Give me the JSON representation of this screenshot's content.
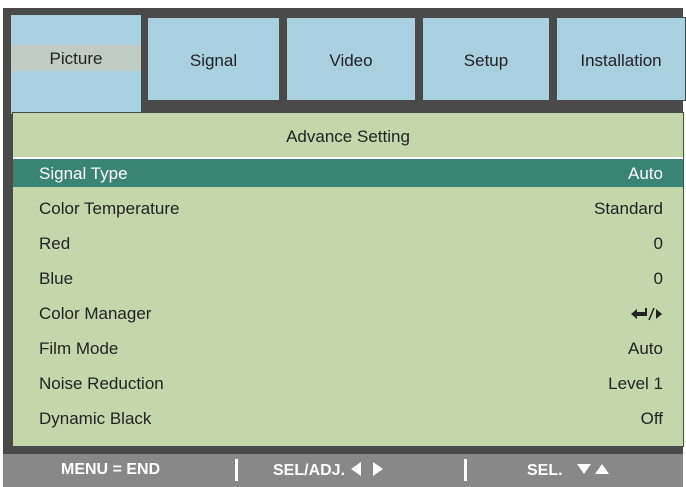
{
  "tabs": [
    {
      "label": "Picture",
      "active": true
    },
    {
      "label": "Signal",
      "active": false
    },
    {
      "label": "Video",
      "active": false
    },
    {
      "label": "Setup",
      "active": false
    },
    {
      "label": "Installation",
      "active": false
    }
  ],
  "panel": {
    "title": "Advance Setting",
    "rows": [
      {
        "label": "Signal Type",
        "value": "Auto",
        "selected": true
      },
      {
        "label": "Color Temperature",
        "value": "Standard"
      },
      {
        "label": "Red",
        "value": "0"
      },
      {
        "label": "Blue",
        "value": "0"
      },
      {
        "label": "Color Manager",
        "value": ""
      },
      {
        "label": "Film Mode",
        "value": "Auto"
      },
      {
        "label": "Noise Reduction",
        "value": "Level 1"
      },
      {
        "label": "Dynamic Black",
        "value": "Off"
      }
    ]
  },
  "footer": {
    "menu_hint": "MENU = END",
    "sel_adj_hint": "SEL/ADJ.",
    "sel_hint": "SEL."
  },
  "colors": {
    "tab_bg": "#a9d0df",
    "panel_bg": "#c4d7aa",
    "selected_row": "#3a8474",
    "footer_bg": "#888888"
  }
}
